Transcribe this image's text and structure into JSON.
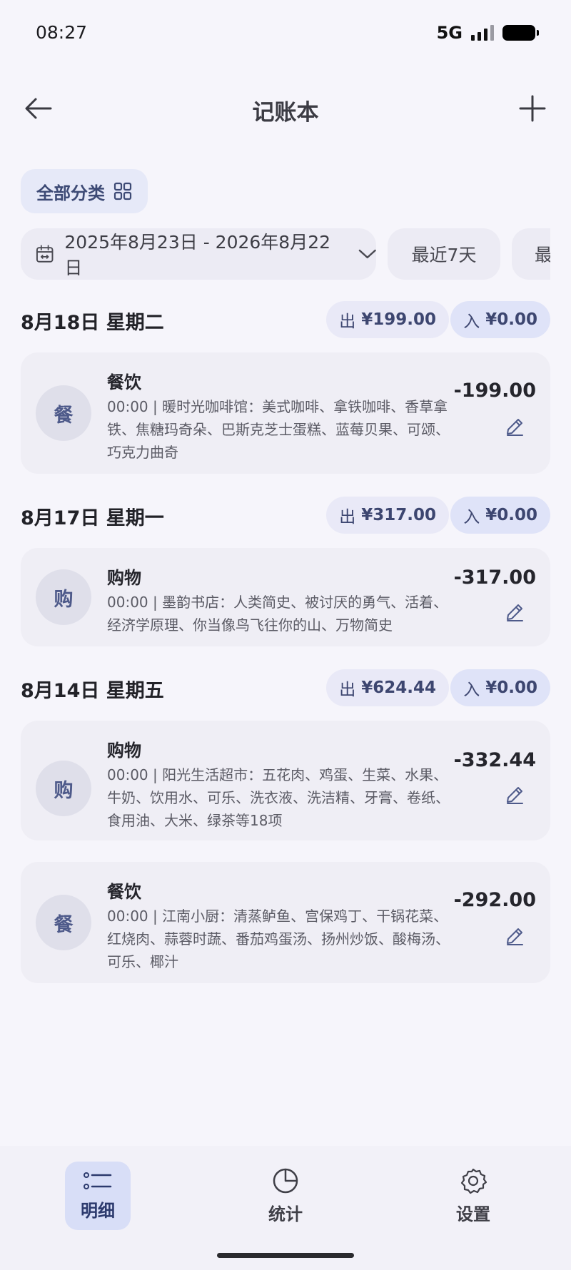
{
  "status_bar": {
    "time": "08:27",
    "network": "5G"
  },
  "header": {
    "title": "记账本"
  },
  "filters": {
    "category_label": "全部分类",
    "date_range": "2025年8月23日 - 2026年8月22日",
    "quick_ranges": [
      "最近7天",
      "最"
    ]
  },
  "days": [
    {
      "date": "8月18日 星期二",
      "out_label": "出",
      "out_amount": "¥199.00",
      "in_label": "入",
      "in_amount": "¥0.00",
      "entries": [
        {
          "avatar": "餐",
          "category": "餐饮",
          "desc": "00:00 | 暖时光咖啡馆：美式咖啡、拿铁咖啡、香草拿铁、焦糖玛奇朵、巴斯克芝士蛋糕、蓝莓贝果、可颂、巧克力曲奇",
          "amount": "-199.00"
        }
      ]
    },
    {
      "date": "8月17日 星期一",
      "out_label": "出",
      "out_amount": "¥317.00",
      "in_label": "入",
      "in_amount": "¥0.00",
      "entries": [
        {
          "avatar": "购",
          "category": "购物",
          "desc": "00:00 | 墨韵书店：人类简史、被讨厌的勇气、活着、经济学原理、你当像鸟飞往你的山、万物简史",
          "amount": "-317.00"
        }
      ]
    },
    {
      "date": "8月14日 星期五",
      "out_label": "出",
      "out_amount": "¥624.44",
      "in_label": "入",
      "in_amount": "¥0.00",
      "entries": [
        {
          "avatar": "购",
          "category": "购物",
          "desc": "00:00 | 阳光生活超市：五花肉、鸡蛋、生菜、水果、牛奶、饮用水、可乐、洗衣液、洗洁精、牙膏、卷纸、食用油、大米、绿茶等18项",
          "amount": "-332.44"
        },
        {
          "avatar": "餐",
          "category": "餐饮",
          "desc": "00:00 | 江南小厨：清蒸鲈鱼、宫保鸡丁、干锅花菜、红烧肉、蒜蓉时蔬、番茄鸡蛋汤、扬州炒饭、酸梅汤、可乐、椰汁",
          "amount": "-292.00"
        }
      ]
    }
  ],
  "bottom_nav": [
    {
      "label": "明细",
      "icon": "list-icon",
      "active": true
    },
    {
      "label": "统计",
      "icon": "pie-chart-icon",
      "active": false
    },
    {
      "label": "设置",
      "icon": "gear-icon",
      "active": false
    }
  ],
  "colors": {
    "accent": "#3d4a75",
    "active_nav_bg": "#d8def7",
    "card_bg": "#efeef5"
  }
}
